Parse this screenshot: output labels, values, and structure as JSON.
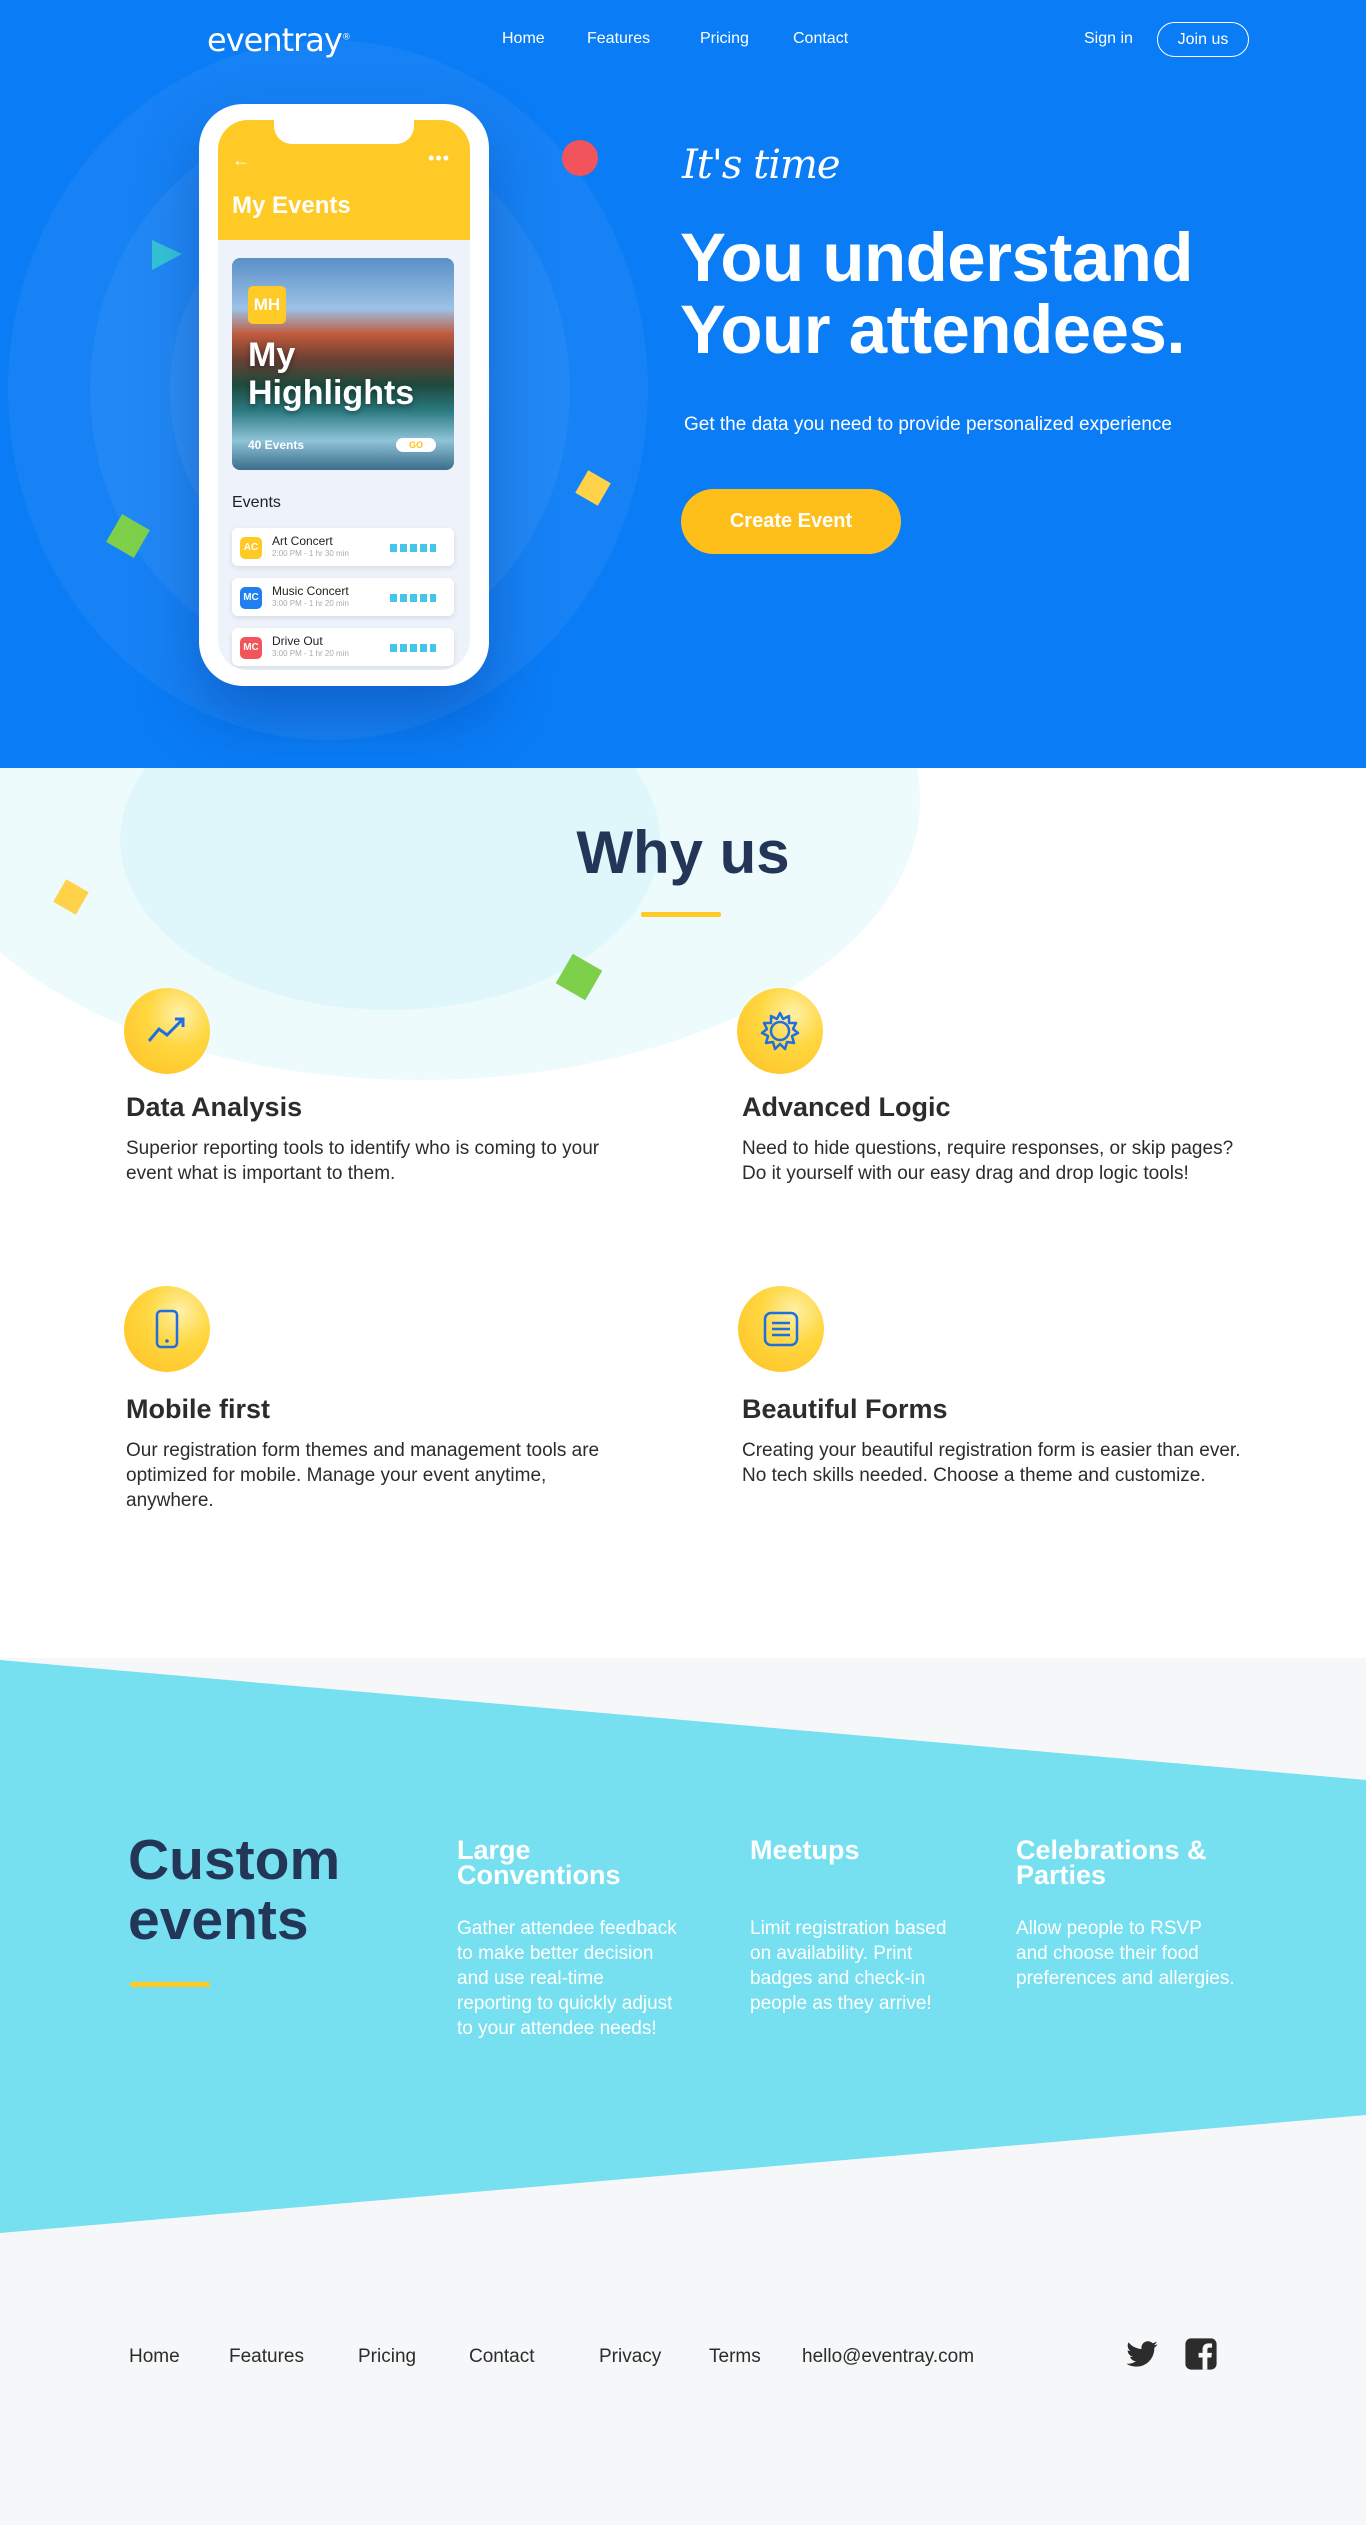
{
  "brand": {
    "logo": "eventray",
    "primary": "#0a7cf5",
    "accent": "#ffbf1a",
    "dark": "#233658",
    "cyan": "#76e0f1"
  },
  "nav": {
    "links": [
      "Home",
      "Features",
      "Pricing",
      "Contact"
    ],
    "signin": "Sign in",
    "join": "Join us"
  },
  "hero": {
    "tagline": "It's time",
    "headline_1": "You understand",
    "headline_2": "Your attendees.",
    "subline": "Get the data you need to provide personalized experience",
    "cta": "Create Event"
  },
  "phone": {
    "title": "My Events",
    "back_icon": "arrow-left-icon",
    "menu_icon": "more-dots-icon",
    "highlight": {
      "badge": "MH",
      "title_1": "My",
      "title_2": "Highlights",
      "count": "40 Events",
      "go": "GO"
    },
    "events_heading": "Events",
    "events": [
      {
        "badge": "AC",
        "name": "Art Concert",
        "time": "2:00 PM - 1 hr 30 min",
        "color": "#ffc926"
      },
      {
        "badge": "MC",
        "name": "Music Concert",
        "time": "3:00 PM - 1 hr 20 min",
        "color": "#1f7ff0"
      },
      {
        "badge": "MC",
        "name": "Drive Out",
        "time": "3:00 PM - 1 hr 20 min",
        "color": "#f2545b"
      }
    ]
  },
  "why": {
    "title": "Why us",
    "features": [
      {
        "icon": "trend-chart-icon",
        "title": "Data Analysis",
        "text": "Superior reporting tools to identify who is coming to your event what is important to them."
      },
      {
        "icon": "gear-icon",
        "title": "Advanced Logic",
        "text": "Need to hide questions, require responses, or skip pages? Do it yourself with our easy drag and drop logic tools!"
      },
      {
        "icon": "mobile-phone-icon",
        "title": "Mobile first",
        "text": "Our registration form themes and management tools are optimized for mobile. Manage your event anytime, anywhere."
      },
      {
        "icon": "form-list-icon",
        "title": "Beautiful Forms",
        "text": "Creating your beautiful registration form is easier than ever. No tech skills needed. Choose a theme and customize."
      }
    ]
  },
  "custom": {
    "title_1": "Custom",
    "title_2": "events",
    "columns": [
      {
        "title_1": "Large",
        "title_2": "Conventions",
        "text": "Gather attendee feedback to make better decision and use real-time reporting to quickly adjust to your attendee needs!"
      },
      {
        "title_1": "Meetups",
        "title_2": "",
        "text": "Limit registration based on availability. Print badges and check-in people as they arrive!"
      },
      {
        "title_1": "Celebrations &",
        "title_2": "Parties",
        "text": "Allow people to RSVP and choose their food preferences and allergies."
      }
    ]
  },
  "footer": {
    "links": [
      "Home",
      "Features",
      "Pricing",
      "Contact",
      "Privacy",
      "Terms"
    ],
    "email": "hello@eventray.com",
    "social": [
      "twitter-icon",
      "facebook-icon"
    ]
  }
}
